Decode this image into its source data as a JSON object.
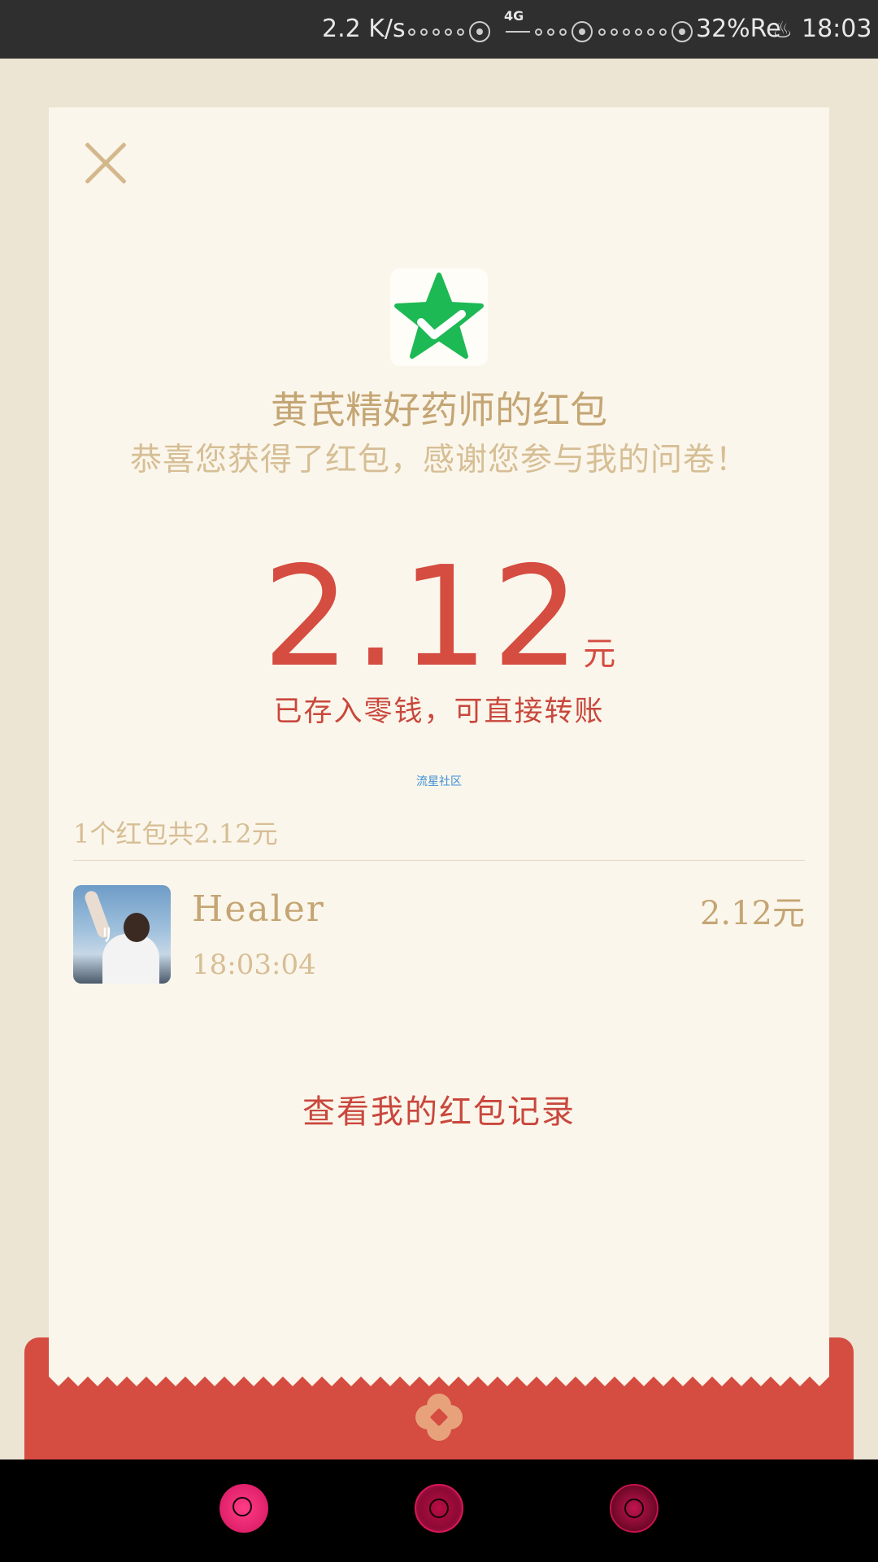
{
  "status_bar": {
    "net_speed": "2.2 K/s",
    "network": "4G",
    "battery": "32%Re",
    "time": "18:03"
  },
  "packet": {
    "title": "黄芪精好药师的红包",
    "message": "恭喜您获得了红包，感谢您参与我的问卷！",
    "amount": "2.12",
    "unit": "元",
    "stored_note": "已存入零钱，可直接转账",
    "community": "流星社区",
    "summary": "1个红包共2.12元"
  },
  "records": [
    {
      "name": "Healer",
      "time": "18:03:04",
      "amount": "2.12元"
    }
  ],
  "actions": {
    "view_records": "查看我的红包记录"
  },
  "icons": {
    "close": "close-icon",
    "logo": "star-check-logo",
    "envelope_badge": "flower-badge-icon",
    "nav": [
      "back-nav-icon",
      "home-nav-icon",
      "recent-nav-icon"
    ]
  },
  "colors": {
    "accent_red": "#d54c41",
    "gold": "#c4a574",
    "card_bg": "#fbf6eb",
    "page_bg": "#ece5d4",
    "logo_green": "#1db954"
  }
}
